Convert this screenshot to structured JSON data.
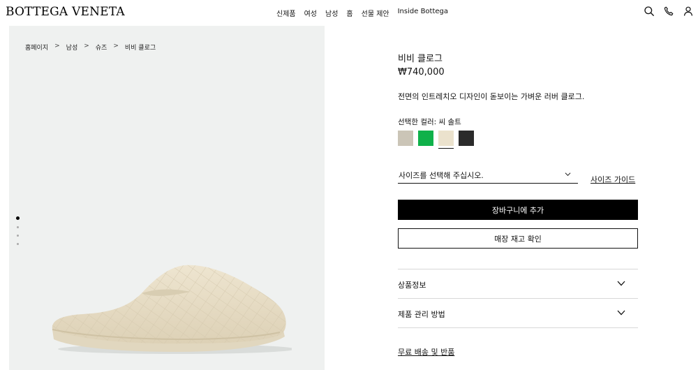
{
  "header": {
    "logo": "BOTTEGA VENETA",
    "nav": [
      "신제품",
      "여성",
      "남성",
      "홈",
      "선물 제안",
      "Inside Bottega"
    ],
    "icons": [
      "search-icon",
      "phone-icon",
      "account-icon"
    ]
  },
  "breadcrumb": [
    "홈페이지",
    "남성",
    "슈즈",
    "비비 클로그"
  ],
  "breadcrumb_separator": ">",
  "gallery": {
    "image_count": 4,
    "active_index": 0
  },
  "product": {
    "name": "비비 클로그",
    "price": "₩740,000",
    "description": "전면의 인트레치오 디자인이 돋보이는 가벼운 러버 클로그.",
    "color_label": "선택한 컬러: 씨 솔트",
    "swatches": [
      {
        "color": "#cbc5b7"
      },
      {
        "color": "#0fb14a"
      },
      {
        "color": "#ebe2cd",
        "selected": true
      },
      {
        "color": "#2b2b2b"
      }
    ],
    "size_placeholder": "사이즈를 선택해 주십시오.",
    "size_guide": "사이즈 가이드",
    "add_to_cart": "장바구니에 추가",
    "store_stock": "매장 재고 확인",
    "accordions": [
      "상품정보",
      "제품 관리 방법"
    ],
    "shipping": "무료 배송 및 반품"
  },
  "colors": {
    "image_background": "#eff1f0",
    "primary_button": "#000000",
    "divider": "#d8d8d8"
  }
}
